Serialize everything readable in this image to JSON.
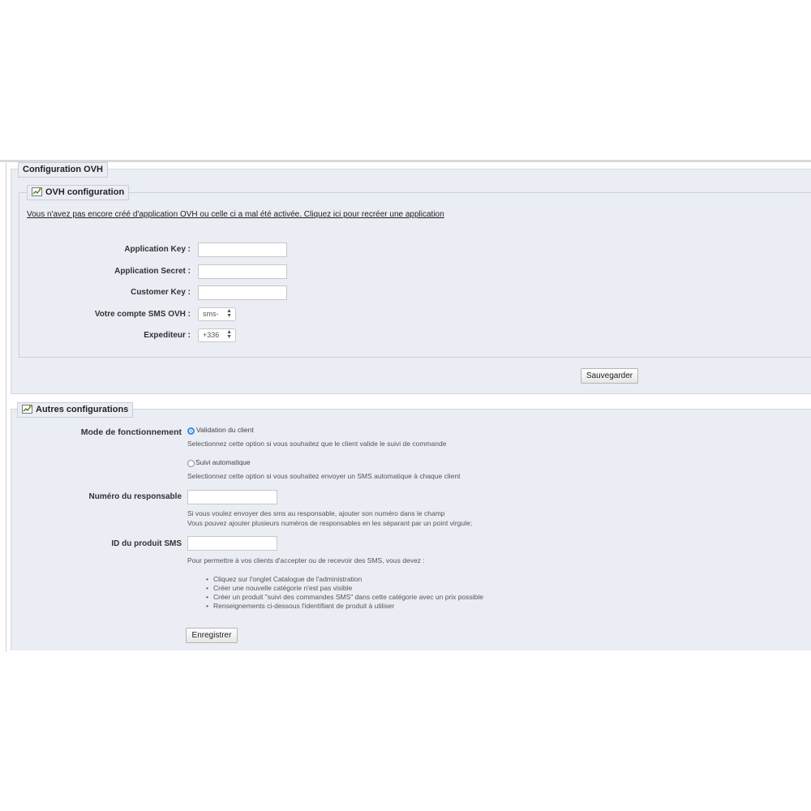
{
  "ovh_section": {
    "title": "Configuration OVH",
    "inner_title": "OVH configuration",
    "warning_link": "Vous n'avez pas encore créé d'application OVH ou celle ci a mal été activée. Cliquez ici pour recréer une application",
    "fields": {
      "app_key_label": "Application Key :",
      "app_key_value": "",
      "app_secret_label": "Application Secret :",
      "app_secret_value": "",
      "customer_key_label": "Customer Key :",
      "customer_key_value": "",
      "sms_account_label": "Votre compte SMS OVH :",
      "sms_account_value": "sms-",
      "sender_label": "Expediteur :",
      "sender_value": "+336"
    },
    "save_button": "Sauvegarder"
  },
  "other_section": {
    "title": "Autres configurations",
    "mode_label": "Mode de fonctionnement",
    "radio_client_label": "Validation du client",
    "radio_client_help": "Selectionnez cette option si vous souhaitez que le client valide le suivi de commande",
    "radio_client_checked": true,
    "radio_auto_label": "Suivi automatique",
    "radio_auto_help": "Selectionnez cette option si vous souhaitez envoyer un SMS automatique à chaque client",
    "radio_auto_checked": false,
    "manager_number_label": "Numéro du responsable",
    "manager_number_value": "",
    "manager_help_1": "Si vous voulez envoyer des sms au responsable, ajouter son numéro dans le champ",
    "manager_help_2": "Vous pouvez ajouter plusieurs numéros de responsables en les séparant par un point virgule;",
    "product_id_label": "ID du produit SMS",
    "product_id_value": "",
    "product_help_intro": "Pour permettre à vos clients d'accepter ou de recevoir des SMS, vous devez :",
    "steps": [
      "Cliquez sur l'onglet Catalogue de l'administration",
      "Créer une nouvelle catégorie n'est pas visible",
      "Créer un produit \"suivi des commandes SMS\" dans cette catégorie avec un prix possible",
      "Renseignements ci-dessous l'identifiant de produit à utiliser"
    ],
    "save_button": "Enregistrer"
  },
  "icons": {
    "legend_icon": "chart-edit-icon"
  },
  "colors": {
    "panel_bg": "#ebedf4",
    "radio_accent": "#3b8be0"
  }
}
